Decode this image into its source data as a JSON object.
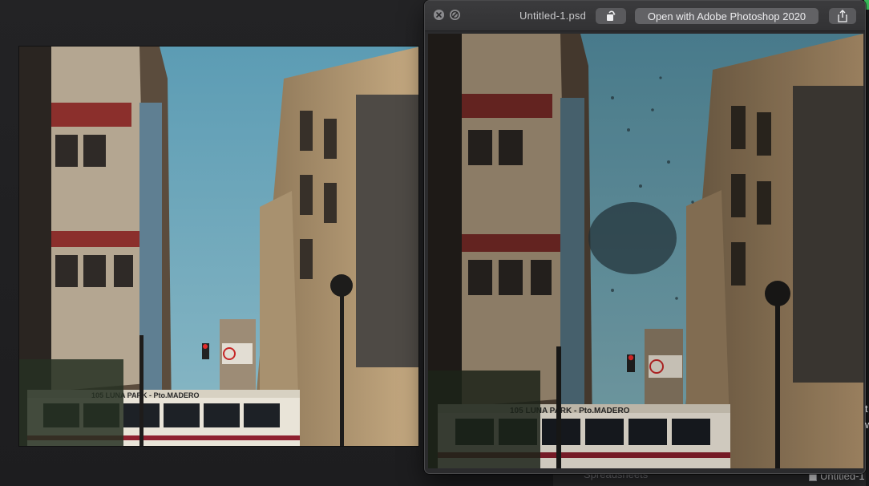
{
  "window": {
    "title": "Untitled-1.psd",
    "open_with_label": "Open with Adobe Photoshop 2020"
  },
  "background": {
    "finder_text": "Spreadsheets",
    "finder_item_label": "Untitled-1",
    "right_edge_letters": "t\nw"
  },
  "icons": {
    "close": "close-icon",
    "fullscreen": "fullscreen-icon",
    "rotate": "rotate-icon",
    "share": "share-icon"
  },
  "colors": {
    "sky": "#6aa6ba",
    "building_warm": "#b89a72",
    "bus_white": "#e9e4d8",
    "bus_red": "#8f2130",
    "window_chrome": "#323234"
  }
}
